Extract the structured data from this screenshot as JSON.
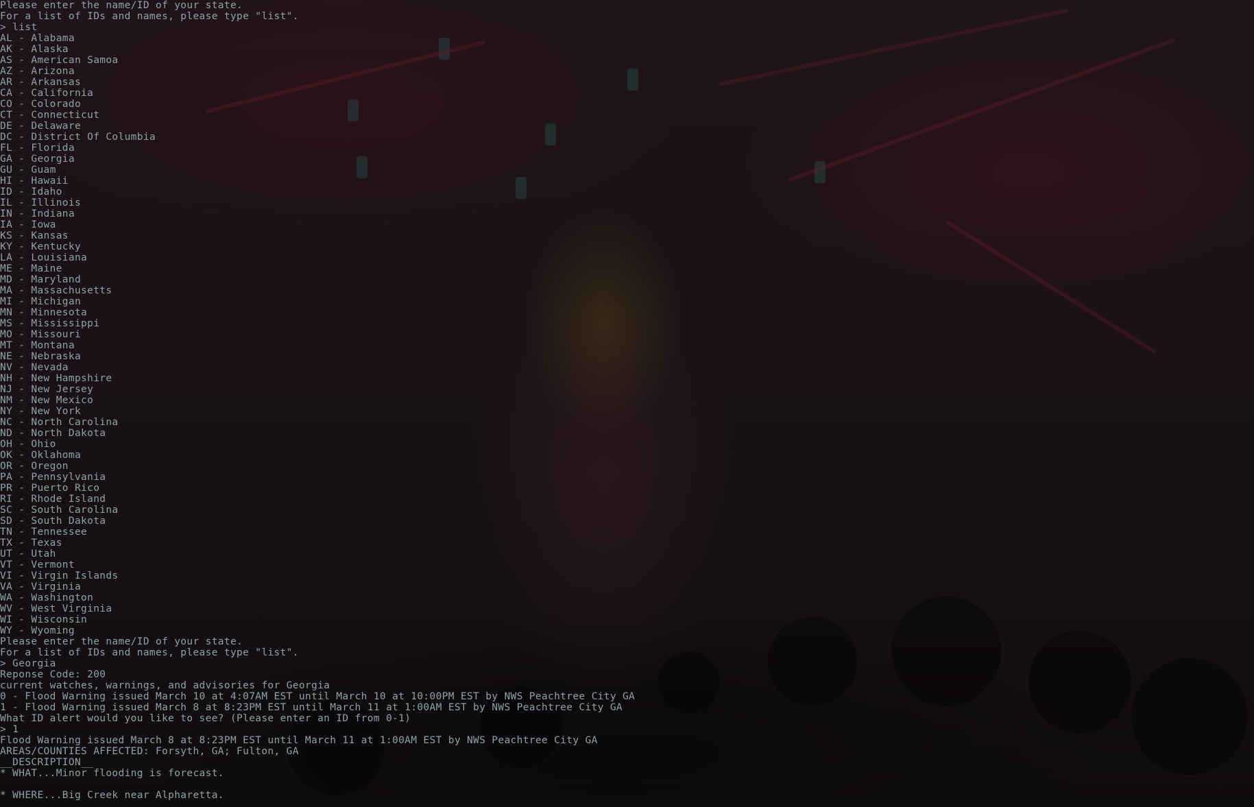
{
  "background_image": "concert-wallpaper",
  "terminal": {
    "text_color": "#8ea3a8",
    "lines": [
      "Please enter the name/ID of your state.",
      "For a list of IDs and names, please type \"list\".",
      "> list",
      "AL - Alabama",
      "AK - Alaska",
      "AS - American Samoa",
      "AZ - Arizona",
      "AR - Arkansas",
      "CA - California",
      "CO - Colorado",
      "CT - Connecticut",
      "DE - Delaware",
      "DC - District Of Columbia",
      "FL - Florida",
      "GA - Georgia",
      "GU - Guam",
      "HI - Hawaii",
      "ID - Idaho",
      "IL - Illinois",
      "IN - Indiana",
      "IA - Iowa",
      "KS - Kansas",
      "KY - Kentucky",
      "LA - Louisiana",
      "ME - Maine",
      "MD - Maryland",
      "MA - Massachusetts",
      "MI - Michigan",
      "MN - Minnesota",
      "MS - Mississippi",
      "MO - Missouri",
      "MT - Montana",
      "NE - Nebraska",
      "NV - Nevada",
      "NH - New Hampshire",
      "NJ - New Jersey",
      "NM - New Mexico",
      "NY - New York",
      "NC - North Carolina",
      "ND - North Dakota",
      "OH - Ohio",
      "OK - Oklahoma",
      "OR - Oregon",
      "PA - Pennsylvania",
      "PR - Puerto Rico",
      "RI - Rhode Island",
      "SC - South Carolina",
      "SD - South Dakota",
      "TN - Tennessee",
      "TX - Texas",
      "UT - Utah",
      "VT - Vermont",
      "VI - Virgin Islands",
      "VA - Virginia",
      "WA - Washington",
      "WV - West Virginia",
      "WI - Wisconsin",
      "WY - Wyoming",
      "Please enter the name/ID of your state.",
      "For a list of IDs and names, please type \"list\".",
      "> Georgia",
      "Reponse Code: 200",
      "current watches, warnings, and advisories for Georgia",
      "0 - Flood Warning issued March 10 at 4:07AM EST until March 10 at 10:00PM EST by NWS Peachtree City GA",
      "1 - Flood Warning issued March 8 at 8:23PM EST until March 11 at 1:00AM EST by NWS Peachtree City GA",
      "What ID alert would you like to see? (Please enter an ID from 0-1)",
      "> 1",
      "Flood Warning issued March 8 at 8:23PM EST until March 11 at 1:00AM EST by NWS Peachtree City GA",
      "AREAS/COUNTIES AFFECTED: Forsyth, GA; Fulton, GA",
      "__DESCRIPTION__",
      "* WHAT...Minor flooding is forecast.",
      "",
      "* WHERE...Big Creek near Alpharetta."
    ]
  }
}
